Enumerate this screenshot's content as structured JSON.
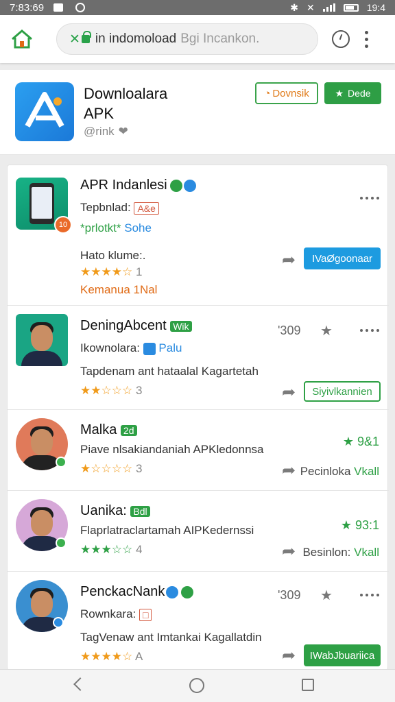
{
  "status": {
    "time": "7:83:69",
    "clock_right": "19:4"
  },
  "browser": {
    "url_secure": "✕",
    "url_host": "in indomoload",
    "url_tail": "Bgi Incankon."
  },
  "header": {
    "title_line1": "Downloalara",
    "title_line2": "APK",
    "subtitle": "@rink",
    "btn_outline": "Dovnsik",
    "btn_filled": "Dede"
  },
  "items": [
    {
      "title": "APR Indanlesi",
      "line2_label": "Tepbnlad:",
      "line2_tag": "A&e",
      "rating_text": "*prlotkt*",
      "rating_suffix": "Sohe",
      "line3": "Hato klume:.",
      "stars": "★★★★☆",
      "star_count": "1",
      "link": "Kemanua 1Nal",
      "badge_num": "10",
      "button": "IVaØgoonaar"
    },
    {
      "title": "DeningAbcent",
      "title_tag": "Wik",
      "line2_label": "Ikownolara:",
      "line2_tail": "Palu",
      "line3": "Tapdenam ant hataalal Kagartetah",
      "stars": "★★☆☆☆",
      "star_count": "3",
      "count": "'309",
      "button": "Siyivlkannien"
    },
    {
      "title": "Malka",
      "title_tag": "2d",
      "line2": "Piave nlsakiandaniah APKledonnsa",
      "stars": "★☆☆☆☆",
      "star_count": "3",
      "rating": "9&1",
      "link_a": "Pecinloka",
      "link_b": "Vkall"
    },
    {
      "title": "Uanika:",
      "title_tag": "Bdl",
      "line2": "Flaprlatraclartamah AIPKedernssi",
      "stars": "★★★☆☆",
      "star_count": "4",
      "rating": "93:1",
      "link_a": "Besinlon:",
      "link_b": "Vkall"
    },
    {
      "title": "PenckacNank",
      "line2_label": "Rownkara:",
      "line2_tag": "□",
      "line3": "TagVenaw ant Imtankai Kagallatdin",
      "stars": "★★★★☆",
      "star_count": "A",
      "count": "'309",
      "button": "IWabJbuariica"
    }
  ],
  "colors": {
    "accent_green": "#2ea045",
    "accent_blue": "#1d9be0",
    "accent_orange": "#e06b16"
  }
}
